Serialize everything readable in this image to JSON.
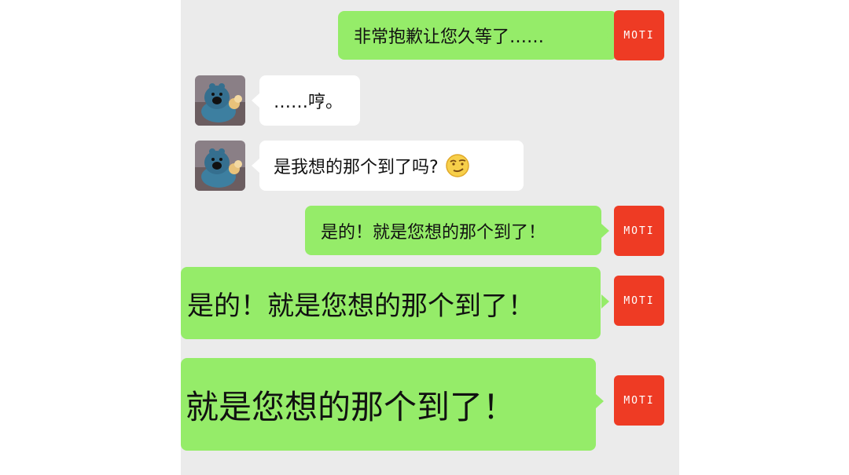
{
  "messages": [
    {
      "id": 1,
      "side": "right",
      "avatar_text": "MOTI",
      "text": "非常抱歉让您久等了……"
    },
    {
      "id": 2,
      "side": "left",
      "text": "……哼。"
    },
    {
      "id": 3,
      "side": "left",
      "text": "是我想的那个到了吗?",
      "emoji": "smirk-face-icon"
    },
    {
      "id": 4,
      "side": "right",
      "avatar_text": "MOTI",
      "text": "是的！就是您想的那个到了！"
    },
    {
      "id": 5,
      "side": "right",
      "avatar_text": "MOTI",
      "text": "是的！就是您想的那个到了！"
    },
    {
      "id": 6,
      "side": "right",
      "avatar_text": "MOTI",
      "text": "就是您想的那个到了！"
    }
  ],
  "colors": {
    "outgoing_bubble": "#95ec69",
    "incoming_bubble": "#ffffff",
    "chat_background": "#ebebeb",
    "moti_avatar": "#ee3b24"
  }
}
